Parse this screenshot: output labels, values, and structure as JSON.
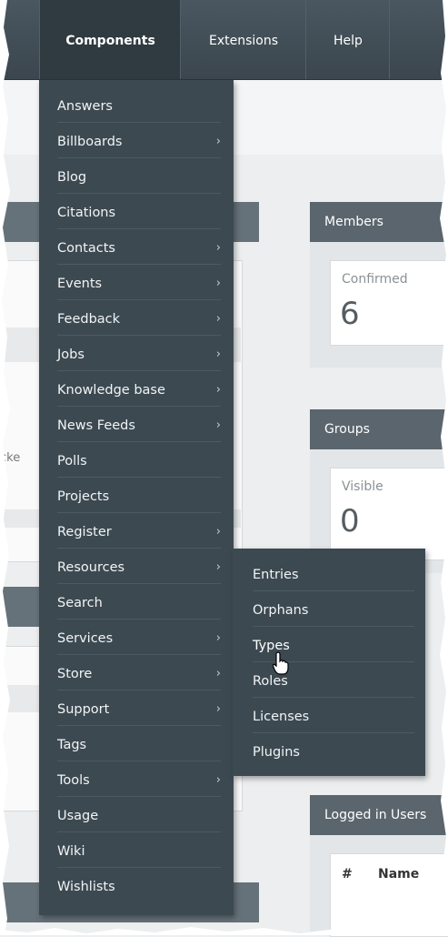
{
  "topnav": [
    {
      "label": "Components",
      "active": true
    },
    {
      "label": "Extensions",
      "active": false
    },
    {
      "label": "Help",
      "active": false
    }
  ],
  "components_menu": [
    {
      "label": "Answers",
      "arrow": ""
    },
    {
      "label": "Billboards",
      "arrow": "›"
    },
    {
      "label": "Blog",
      "arrow": ""
    },
    {
      "label": "Citations",
      "arrow": ""
    },
    {
      "label": "Contacts",
      "arrow": "›"
    },
    {
      "label": "Events",
      "arrow": "›"
    },
    {
      "label": "Feedback",
      "arrow": "›"
    },
    {
      "label": "Jobs",
      "arrow": "›"
    },
    {
      "label": "Knowledge base",
      "arrow": "›"
    },
    {
      "label": "News Feeds",
      "arrow": "›"
    },
    {
      "label": "Polls",
      "arrow": ""
    },
    {
      "label": "Projects",
      "arrow": ""
    },
    {
      "label": "Register",
      "arrow": "›"
    },
    {
      "label": "Resources",
      "arrow": "›"
    },
    {
      "label": "Search",
      "arrow": ""
    },
    {
      "label": "Services",
      "arrow": "›"
    },
    {
      "label": "Store",
      "arrow": "›"
    },
    {
      "label": "Support",
      "arrow": "›"
    },
    {
      "label": "Tags",
      "arrow": ""
    },
    {
      "label": "Tools",
      "arrow": "›"
    },
    {
      "label": "Usage",
      "arrow": ""
    },
    {
      "label": "Wiki",
      "arrow": ""
    },
    {
      "label": "Wishlists",
      "arrow": ""
    }
  ],
  "resources_submenu": [
    {
      "label": "Entries"
    },
    {
      "label": "Orphans"
    },
    {
      "label": "Types"
    },
    {
      "label": "Roles"
    },
    {
      "label": "Licenses"
    },
    {
      "label": "Plugins"
    }
  ],
  "modules": {
    "members": {
      "title": "Members",
      "stat_label": "Confirmed",
      "stat_value": "6"
    },
    "groups": {
      "title": "Groups",
      "stat_label": "Visible",
      "stat_value": "0"
    },
    "logged_in": {
      "title": "Logged in Users",
      "col_hash": "#",
      "col_name": "Name"
    }
  },
  "background": {
    "cut_text": "cke"
  },
  "colors": {
    "menu_bg": "#3c4951",
    "topbar": "#424e56",
    "module_head": "#5a656d"
  },
  "icons": {
    "arrow": "chevron-right-icon",
    "cursor": "hand-pointer-icon"
  }
}
